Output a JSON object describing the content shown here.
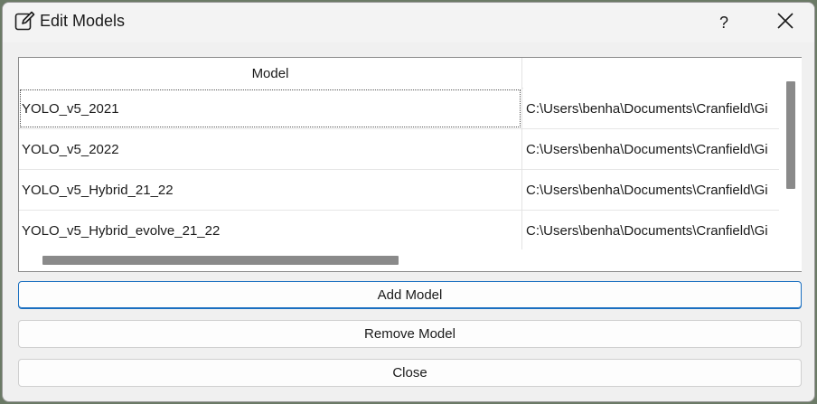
{
  "window": {
    "title": "Edit Models",
    "help_label": "?",
    "close_icon": "close-icon",
    "title_icon": "edit-icon"
  },
  "table": {
    "columns": [
      "Model",
      ""
    ],
    "rows": [
      {
        "name": "YOLO_v5_2021",
        "path": "C:\\Users\\benha\\Documents\\Cranfield\\Gi"
      },
      {
        "name": "YOLO_v5_2022",
        "path": "C:\\Users\\benha\\Documents\\Cranfield\\Gi"
      },
      {
        "name": "YOLO_v5_Hybrid_21_22",
        "path": "C:\\Users\\benha\\Documents\\Cranfield\\Gi"
      },
      {
        "name": "YOLO_v5_Hybrid_evolve_21_22",
        "path": "C:\\Users\\benha\\Documents\\Cranfield\\Gi"
      }
    ]
  },
  "buttons": {
    "add": "Add Model",
    "remove": "Remove Model",
    "close": "Close"
  },
  "colors": {
    "accent": "#1a6fc0",
    "scrollbar": "#8a8a8a"
  }
}
